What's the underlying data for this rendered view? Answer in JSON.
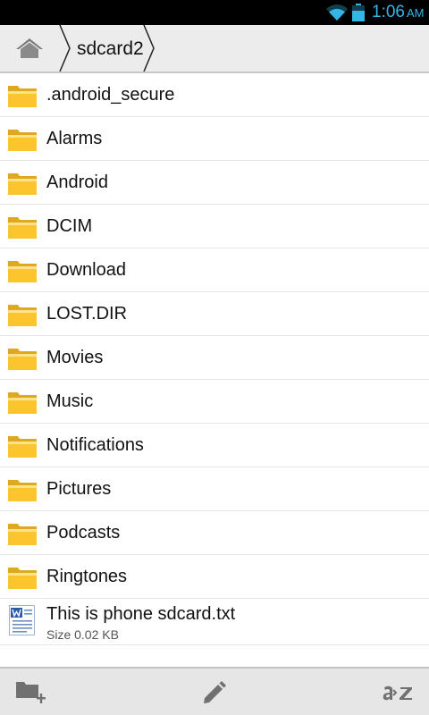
{
  "status_bar": {
    "time": "1:06",
    "ampm": "AM",
    "accent_color": "#33b5e5",
    "icons": [
      "wifi-icon",
      "battery-icon"
    ]
  },
  "breadcrumb": {
    "home_icon": "home-icon",
    "current": "sdcard2"
  },
  "folders": [
    ".android_secure",
    "Alarms",
    "Android",
    "DCIM",
    "Download",
    "LOST.DIR",
    "Movies",
    "Music",
    "Notifications",
    "Pictures",
    "Podcasts",
    "Ringtones"
  ],
  "files": [
    {
      "name": "This is phone sdcard.txt",
      "size": "Size 0.02 KB",
      "icon": "word-document-icon"
    }
  ],
  "toolbar": {
    "icons": [
      "new-folder-icon",
      "edit-icon",
      "sort-az-icon"
    ]
  }
}
